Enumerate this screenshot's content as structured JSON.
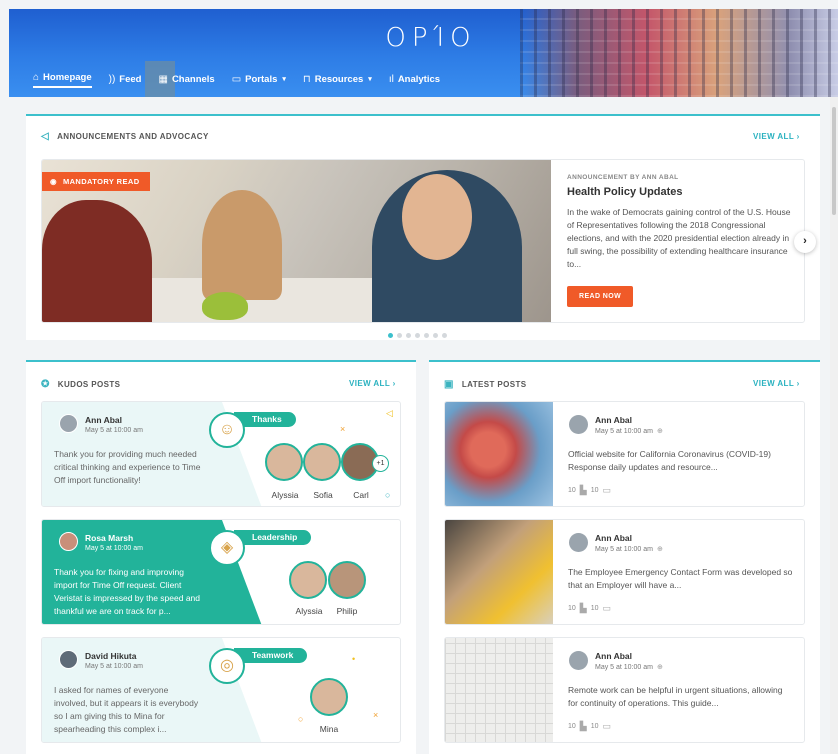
{
  "header": {
    "logo": "ΟΡΊΟ",
    "nav": [
      {
        "label": "Homepage",
        "icon": "⌂"
      },
      {
        "label": "Feed",
        "icon": "))"
      },
      {
        "label": "Channels",
        "icon": "▦"
      },
      {
        "label": "Portals",
        "icon": "▭",
        "caret": "▾"
      },
      {
        "label": "Resources",
        "icon": "⊓",
        "caret": "▾"
      },
      {
        "label": "Analytics",
        "icon": "ıl"
      }
    ]
  },
  "announcements": {
    "title": "ANNOUNCEMENTS AND ADVOCACY",
    "view_all": "VIEW ALL ›",
    "badge": "MANDATORY READ",
    "eyebrow": "ANNOUNCEMENT BY ANN ABAL",
    "headline": "Health Policy Updates",
    "body": "In the wake of Democrats gaining control of the U.S. House of Representatives following the 2018 Congressional elections, and with the 2020 presidential election already in full swing, the possibility of extending healthcare insurance to...",
    "cta": "READ NOW",
    "next": "›"
  },
  "kudos": {
    "title": "KUDOS POSTS",
    "view_all": "VIEW ALL ›",
    "items": [
      {
        "name": "Ann Abal",
        "date": "May 5 at 10:00 am",
        "message": "Thank you for providing much needed critical thinking and experience to Time Off import functionality!",
        "tag": "Thanks",
        "recipients": [
          "Alyssia",
          "Sofia",
          "Carl"
        ],
        "more": "+1"
      },
      {
        "name": "Rosa Marsh",
        "date": "May 5 at 10:00 am",
        "message": "Thank you for fixing and improving import for Time Off request. Client Veristat is impressed by the speed and thankful we are on track for p...",
        "tag": "Leadership",
        "recipients": [
          "Alyssia",
          "Philip"
        ]
      },
      {
        "name": "David Hikuta",
        "date": "May 5 at 10:00 am",
        "message": "I asked for names of everyone involved, but it appears it is everybody so I am giving this to Mina for spearheading this complex i...",
        "tag": "Teamwork",
        "recipients": [
          "Mina"
        ]
      }
    ]
  },
  "latest": {
    "title": "LATEST POSTS",
    "view_all": "VIEW ALL ›",
    "items": [
      {
        "name": "Ann Abal",
        "date": "May 5 at 10:00 am",
        "message": "Official website for California Coronavirus (COVID-19) Response daily updates and resource...",
        "likes": "10",
        "comments": "10"
      },
      {
        "name": "Ann Abal",
        "date": "May 5 at 10:00 am",
        "message": "The Employee Emergency Contact Form was developed so that an Employer will have a...",
        "likes": "10",
        "comments": "10"
      },
      {
        "name": "Ann Abal",
        "date": "May 5 at 10:00 am",
        "message": "Remote work can be helpful in urgent situations, allowing for continuity of operations. This guide...",
        "likes": "10",
        "comments": "10"
      }
    ]
  },
  "colors": {
    "accent": "#3cc0cc",
    "orange": "#f05a28",
    "green": "#22b39a"
  }
}
